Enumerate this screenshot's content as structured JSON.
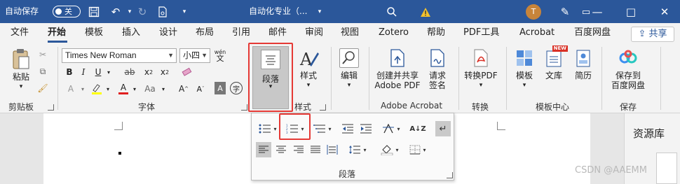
{
  "titlebar": {
    "autosave": "自动保存",
    "toggle_state": "关",
    "doc_title": "自动化专业（...",
    "avatar_letter": "T",
    "colors": {
      "bg": "#2b579a",
      "avatar": "#c7843a",
      "warning": "#f2c12e"
    }
  },
  "tabs": [
    "文件",
    "开始",
    "模板",
    "插入",
    "设计",
    "布局",
    "引用",
    "邮件",
    "审阅",
    "视图",
    "Zotero",
    "帮助",
    "PDF工具",
    "Acrobat",
    "百度网盘"
  ],
  "share_label": "共享",
  "ribbon": {
    "clipboard": {
      "paste": "粘贴",
      "group": "剪贴板"
    },
    "font": {
      "name": "Times New Roman",
      "size": "小四",
      "wen": "wén",
      "group": "字体"
    },
    "paragraph": {
      "label": "段落"
    },
    "styles": {
      "label": "样式",
      "group": "样式"
    },
    "editing": {
      "label": "编辑"
    },
    "acrobat": {
      "create": "创建并共享",
      "create2": "Adobe PDF",
      "request": "请求",
      "request2": "签名",
      "group": "Adobe Acrobat"
    },
    "convert": {
      "label": "转换PDF",
      "group": "转换"
    },
    "templates": {
      "template": "模板",
      "library": "文库",
      "resume": "简历",
      "new_badge": "NEW",
      "group": "模板中心"
    },
    "save": {
      "label1": "保存到",
      "label2": "百度网盘",
      "group": "保存"
    }
  },
  "flyout": {
    "label": "段落"
  },
  "sidepanel": {
    "label": "资源库"
  },
  "watermark": "CSDN @AAEMM"
}
